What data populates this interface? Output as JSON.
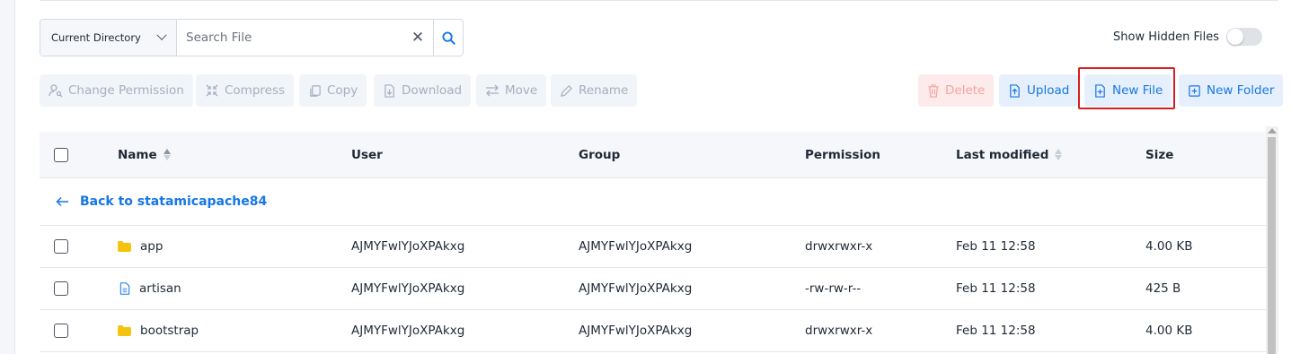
{
  "search": {
    "directory_label": "Current Directory",
    "placeholder": "Search File",
    "value": ""
  },
  "hidden_files": {
    "label": "Show Hidden Files",
    "enabled": false
  },
  "toolbar": {
    "change_permission": "Change Permission",
    "compress": "Compress",
    "copy": "Copy",
    "download": "Download",
    "move": "Move",
    "rename": "Rename",
    "delete": "Delete",
    "upload": "Upload",
    "new_file": "New File",
    "new_folder": "New Folder"
  },
  "colors": {
    "accent": "#1677e5",
    "folder": "#f5c20d",
    "highlight": "#d81e1e"
  },
  "table": {
    "headers": {
      "name": "Name",
      "user": "User",
      "group": "Group",
      "permission": "Permission",
      "last_modified": "Last modified",
      "size": "Size"
    },
    "back_link": "Back to statamicapache84",
    "rows": [
      {
        "type": "folder",
        "name": "app",
        "user": "AJMYFwlYJoXPAkxg",
        "group": "AJMYFwlYJoXPAkxg",
        "permission": "drwxrwxr-x",
        "modified": "Feb 11 12:58",
        "size": "4.00 KB"
      },
      {
        "type": "file",
        "name": "artisan",
        "user": "AJMYFwlYJoXPAkxg",
        "group": "AJMYFwlYJoXPAkxg",
        "permission": "-rw-rw-r--",
        "modified": "Feb 11 12:58",
        "size": "425 B"
      },
      {
        "type": "folder",
        "name": "bootstrap",
        "user": "AJMYFwlYJoXPAkxg",
        "group": "AJMYFwlYJoXPAkxg",
        "permission": "drwxrwxr-x",
        "modified": "Feb 11 12:58",
        "size": "4.00 KB"
      }
    ]
  }
}
